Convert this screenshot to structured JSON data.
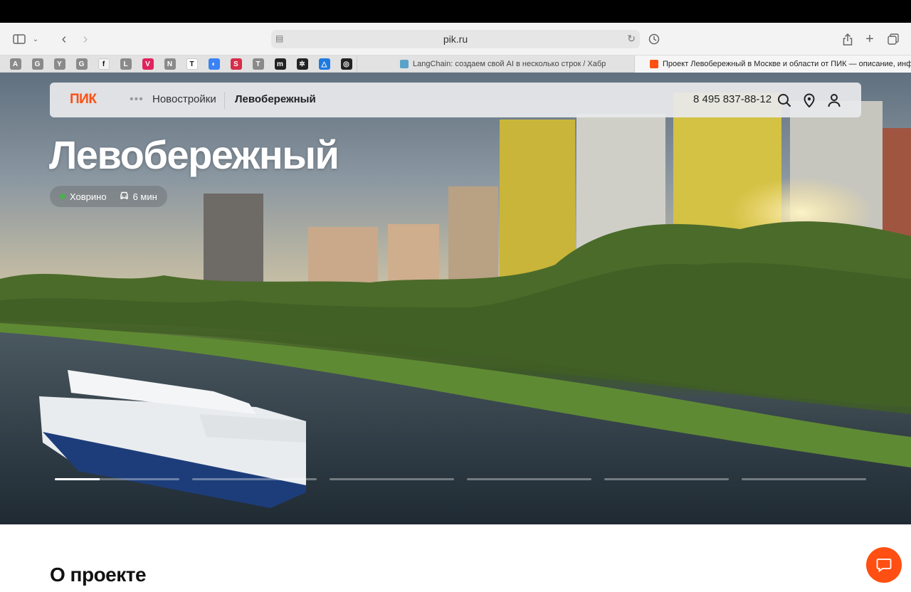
{
  "browser": {
    "url": "pik.ru",
    "pinned_tabs": [
      {
        "icon": "A",
        "color": "#8a8a8a"
      },
      {
        "icon": "G",
        "color": "#8a8a8a"
      },
      {
        "icon": "Y",
        "color": "#8a8a8a"
      },
      {
        "icon": "G",
        "color": "#8a8a8a"
      },
      {
        "icon": "f",
        "color": "#f3f3f3"
      },
      {
        "icon": "L",
        "color": "#8a8a8a"
      },
      {
        "icon": "V",
        "color": "#e0245e"
      },
      {
        "icon": "N",
        "color": "#8a8a8a"
      },
      {
        "icon": "T",
        "color": "#ffffff"
      },
      {
        "icon": "◐",
        "color": "#3b82f6"
      },
      {
        "icon": "S",
        "color": "#d62d4a"
      },
      {
        "icon": "T",
        "color": "#8a8a8a"
      },
      {
        "icon": "m",
        "color": "#222222"
      },
      {
        "icon": "✲",
        "color": "#222222"
      },
      {
        "icon": "△",
        "color": "#1f7ae0"
      },
      {
        "icon": "◎",
        "color": "#222222"
      }
    ],
    "tabs": [
      {
        "label": "LangChain: создаем свой AI в несколько строк / Хабр",
        "active": false
      },
      {
        "label": "Проект Левобережный в Москве и области от ПИК — описание, инфра...",
        "active": true
      }
    ]
  },
  "site": {
    "logo": "ПИК",
    "breadcrumb": [
      "Новостройки",
      "Левобережный"
    ],
    "phone": "8 495 837-88-12",
    "brand_color": "#ff4f12"
  },
  "hero": {
    "title": "Левобережный",
    "metro": "Ховрино",
    "travel_time": "6 мин",
    "slides": 6,
    "active_slide": 0,
    "active_slide_progress": 0.36
  },
  "section": {
    "about_title": "О проекте"
  }
}
